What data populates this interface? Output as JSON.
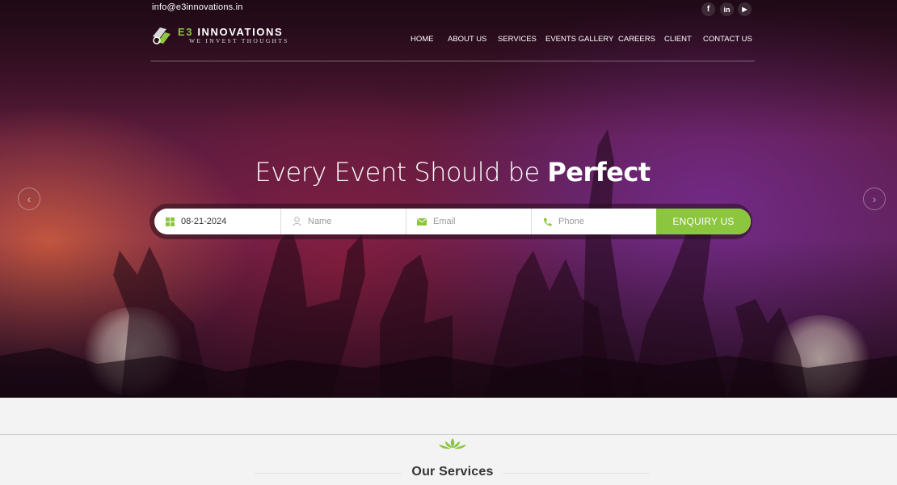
{
  "topbar": {
    "email": "info@e3innovations.in"
  },
  "social": [
    {
      "name": "facebook-icon",
      "glyph": "f"
    },
    {
      "name": "linkedin-icon",
      "glyph": "in"
    },
    {
      "name": "youtube-icon",
      "glyph": "▶"
    }
  ],
  "logo": {
    "prefix": "E3",
    "name": " INNOVATIONS",
    "tagline": "WE INVEST THOUGHTS"
  },
  "nav": [
    "HOME",
    "ABOUT US",
    "SERVICES",
    "EVENTS GALLERY",
    "CAREERS",
    "CLIENT",
    "CONTACT US"
  ],
  "hero": {
    "headline_light": "Every Event Should be ",
    "headline_bold": "Perfect",
    "prev_glyph": "‹",
    "next_glyph": "›"
  },
  "form": {
    "date_value": "08-21-2024",
    "name_placeholder": "Name",
    "email_placeholder": "Email",
    "phone_placeholder": "Phone",
    "submit_label": "ENQUIRY US"
  },
  "services": {
    "title": "Our Services"
  },
  "colors": {
    "accent": "#8cc63f",
    "hero_dark": "#2a0e1c",
    "hero_purple": "#5b1f4e"
  }
}
